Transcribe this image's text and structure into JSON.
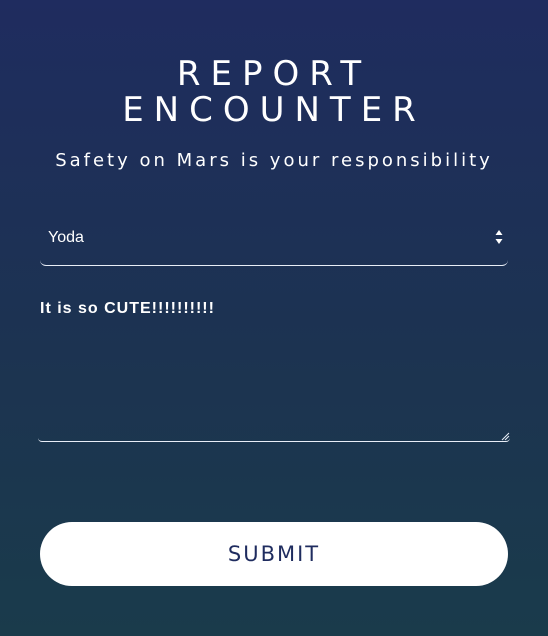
{
  "header": {
    "title_line1": "REPORT",
    "title_line2": "ENCOUNTER",
    "subtitle": "Safety on Mars is your responsibility"
  },
  "form": {
    "select": {
      "value": "Yoda"
    },
    "textarea": {
      "value": "It is so CUTE!!!!!!!!!!"
    },
    "submit_label": "SUBMIT"
  },
  "icons": {
    "select_arrows": "up-down-chevron-icon",
    "resize": "resize-handle-icon"
  },
  "colors": {
    "background_top": "#1f2c5f",
    "background_bottom": "#1a3b4b",
    "text": "#ffffff",
    "button_bg": "#ffffff",
    "button_text": "#1f2c5f"
  }
}
